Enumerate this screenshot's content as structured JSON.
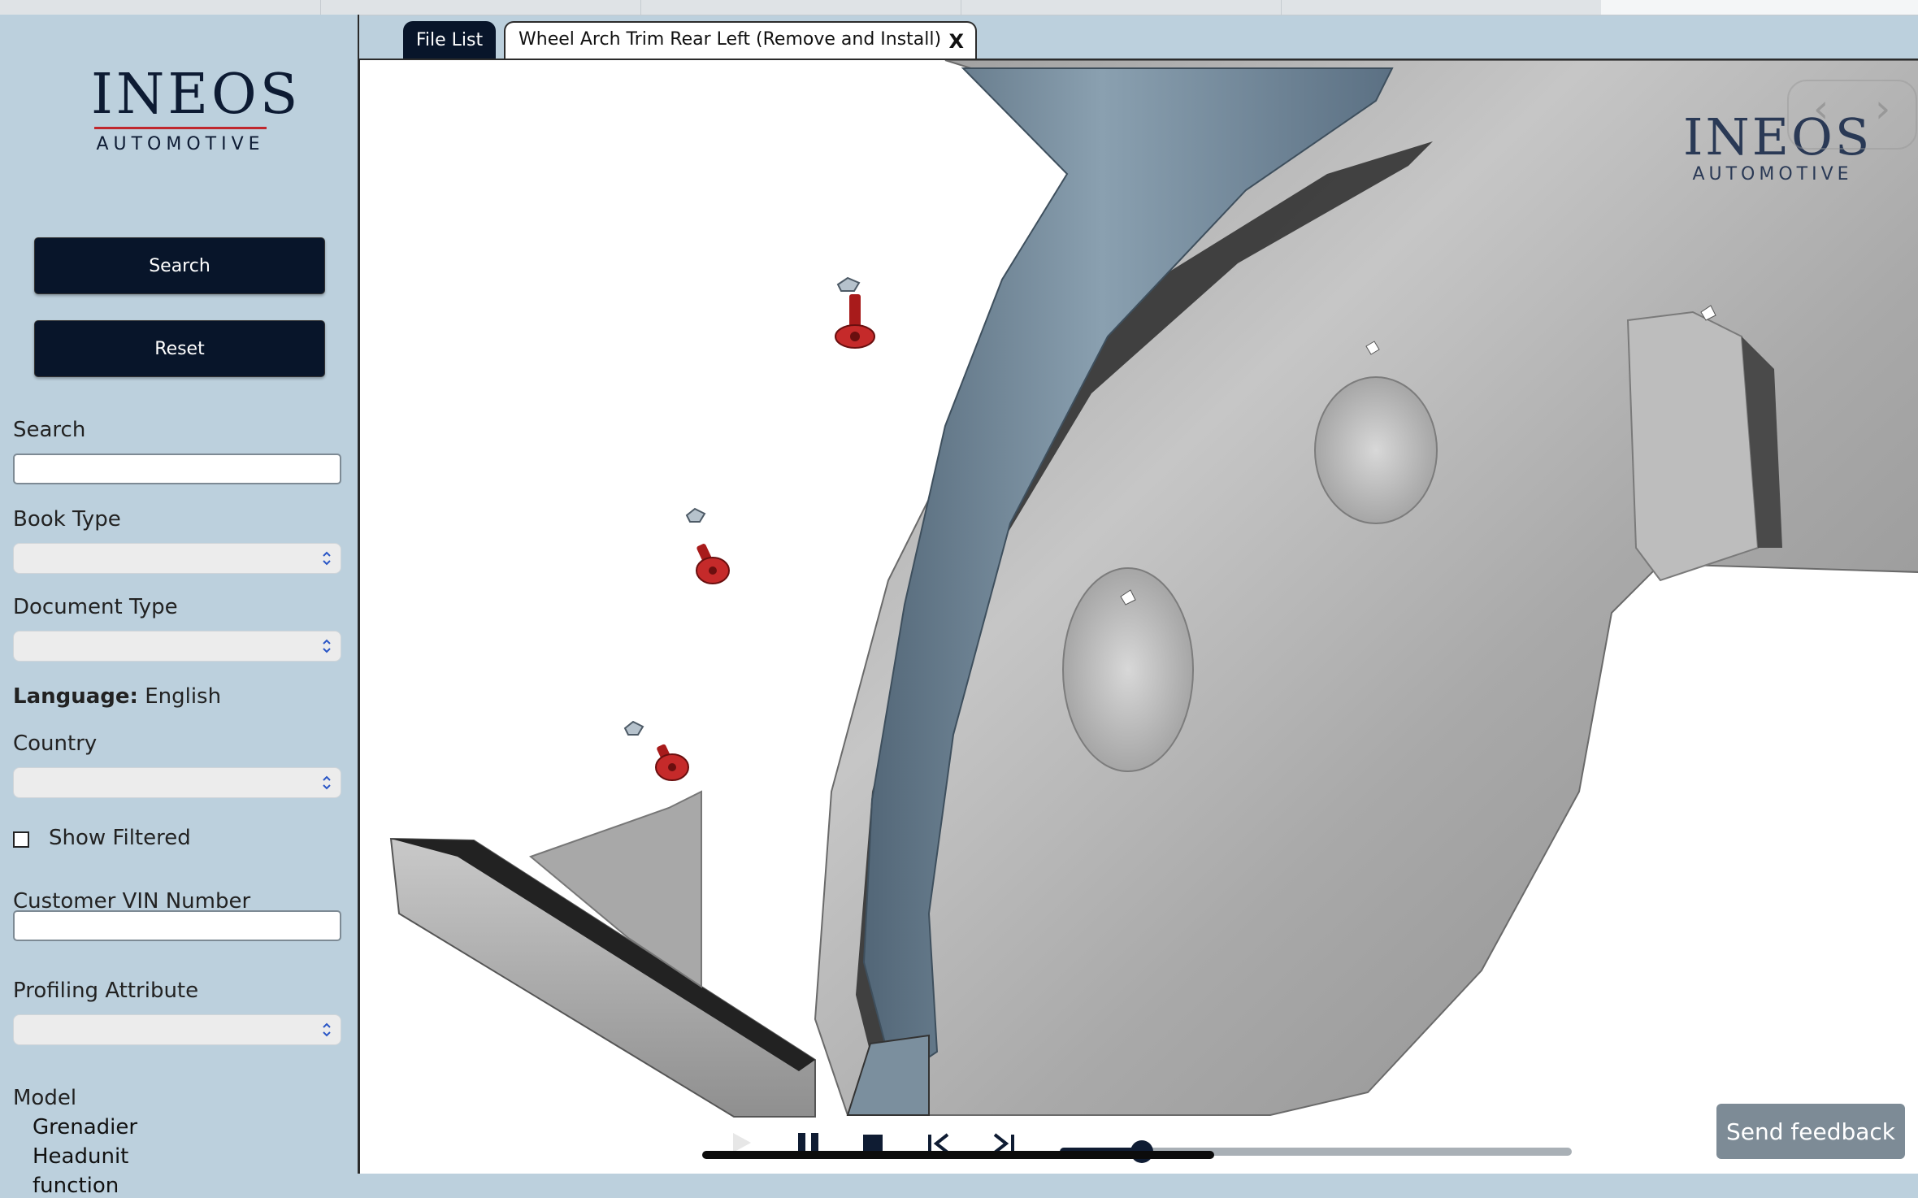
{
  "sidebar": {
    "logo": {
      "brand": "INEOS",
      "sub": "AUTOMOTIVE"
    },
    "search_button": "Search",
    "reset_button": "Reset",
    "search_label": "Search",
    "search_value": "",
    "book_type_label": "Book Type",
    "book_type_value": "",
    "document_type_label": "Document Type",
    "document_type_value": "",
    "language_label": "Language:",
    "language_value": "English",
    "country_label": "Country",
    "country_value": "",
    "show_filtered_label": "Show Filtered",
    "show_filtered_checked": false,
    "vin_label": "Customer VIN Number",
    "vin_value": "",
    "profiling_label": "Profiling Attribute",
    "profiling_value": "",
    "model_label": "Model",
    "model_items": [
      "Grenadier",
      "Headunit",
      "function"
    ]
  },
  "tabs": [
    {
      "label": "File List",
      "active": false
    },
    {
      "label": "Wheel Arch Trim Rear Left (Remove and Install)",
      "active": true,
      "close": "X"
    }
  ],
  "viewer": {
    "watermark": {
      "brand": "INEOS",
      "sub": "AUTOMOTIVE"
    },
    "nav_prev": "‹",
    "nav_next": "›",
    "player": {
      "progress": 0.16
    }
  },
  "feedback_button": "Send feedback",
  "colors": {
    "accent_dark": "#08152a",
    "sidebar_bg": "#bcd0dd",
    "screw_red": "#b21e1e",
    "trim_blue": "#6f8798"
  }
}
